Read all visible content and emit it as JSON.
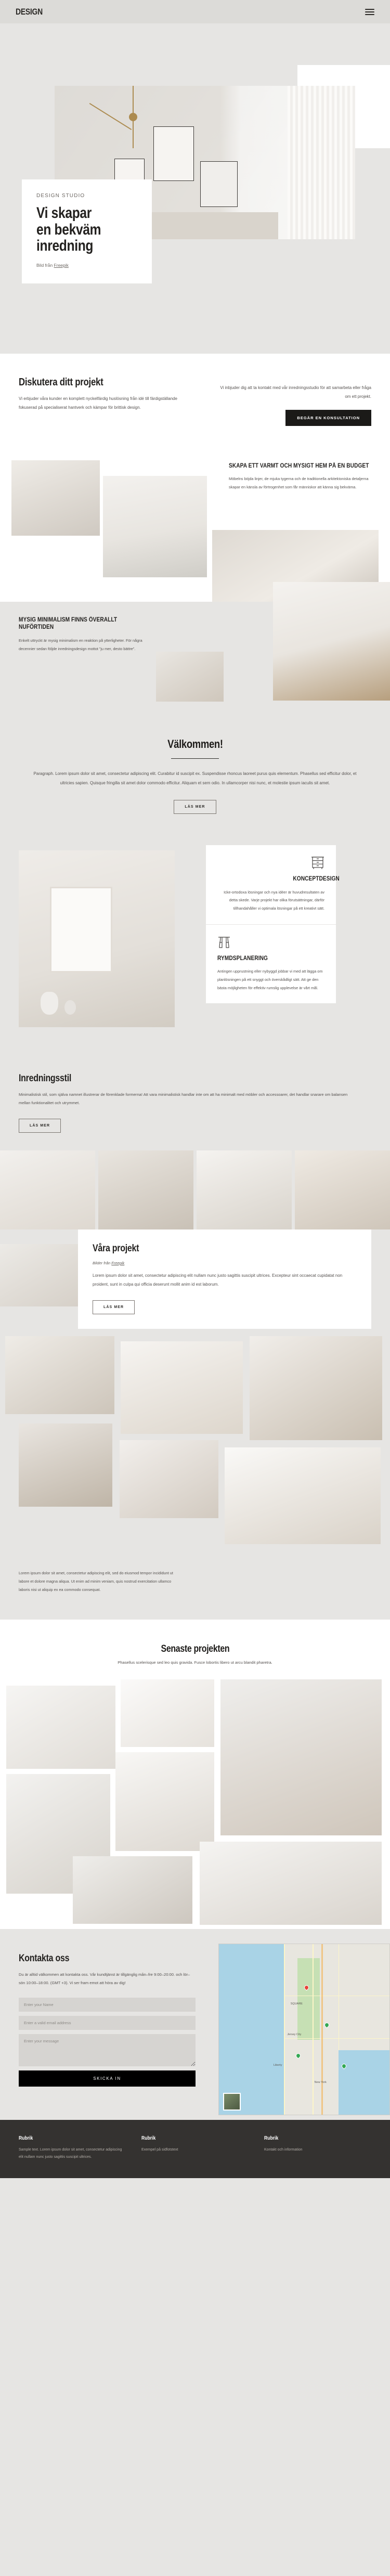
{
  "header": {
    "logo": "DESIGN",
    "menu_icon": "hamburger-icon"
  },
  "hero": {
    "eyebrow": "DESIGN STUDIO",
    "title_line1": "Vi skapar",
    "title_line2": "en bekväm",
    "title_line3": "inredning",
    "credit_prefix": "Bild från ",
    "credit_link": "Freepik"
  },
  "discuss": {
    "heading": "Diskutera ditt projekt",
    "paragraph": "Vi erbjuder våra kunder en komplett nyckelfärdig huslösning från idé till färdigställande fokuserad på specialiserat hantverk och kämpar för brittisk design.",
    "right_text": "Vi inbjuder dig att ta kontakt med vår inredningsstudio för att samarbeta eller fråga om ett projekt.",
    "button": "BEGÄR EN KONSULTATION"
  },
  "feature_warm": {
    "heading": "SKAPA ETT VARMT OCH MYSIGT HEM PÅ EN BUDGET",
    "paragraph": "Möbelns böjda linjer, de mjuka tygerna och de traditionella arkitektoniska detaljerna skapar en känsla av förtrogenhet som får människor att känna sig bekväma."
  },
  "feature_minimal": {
    "heading": "MYSIG MINIMALISM FINNS ÖVERALLT NUFÖRTIDEN",
    "paragraph": "Enkelt uttryckt är mysig minimalism en reaktion på ytterligheter. För några decennier sedan följde inredningsdesign mottot ”ju mer, desto bättre”."
  },
  "welcome": {
    "heading": "Välkommen!",
    "paragraph": "Paragraph. Lorem ipsum dolor sit amet, consectetur adipiscing elit. Curabitur id suscipit ex. Suspendisse rhoncus laoreet purus quis elementum. Phasellus sed efficitur dolor, et ultricies sapien. Quisque fringilla sit amet dolor commodo efficitur. Aliquam et sem odio. In ullamcorper nisi nunc, et molestie ipsum iaculis sit amet.",
    "button": "LÄS MER"
  },
  "services": [
    {
      "icon": "dresser-icon",
      "title": "KONCEPTDESIGN",
      "text": "Icke-ortodoxa lösningar och nya idéer är huvudresultaten av detta skede. Varje projekt har olika förutsättningar, därför tillhandahåller vi optimala lösningar på ett kreativt sätt."
    },
    {
      "icon": "curtains-icon",
      "title": "RYMDSPLANERING",
      "text": "Antingen upprustning eller nybyggd jobbar vi med att lägga om planlösningen på ett snyggt och överskådligt sätt. Att ge den bästa möjligheten för effektiv rumslig upplevelse är vårt mål."
    }
  ],
  "style_section": {
    "heading": "Inredningsstil",
    "paragraph": "Minimalistisk stil, som själva namnet illustrerar de förenklade formerna! Att vara minimalistisk handlar inte om att ha minimalt med möbler och accessoarer, det handlar snarare om balansen mellan funktionalitet och utrymmet.",
    "button": "LÄS MER"
  },
  "projects": {
    "heading": "Våra projekt",
    "credit_prefix": "Bilder från ",
    "credit_link": "Freepik",
    "paragraph": "Lorem ipsum dolor sit amet, consectetur adipiscing elit nullam nunc justo sagittis suscipit ultrices. Excepteur sint occaecat cupidatat non proident, sunt in culpa qui officia deserunt mollit anim id est laborum.",
    "button": "LÄS MER",
    "footer_text": "Lorem ipsum dolor sit amet, consectetur adipiscing elit, sed do eiusmod tempor incididunt ut labore et dolore magna aliqua. Ut enim ad minim veniam, quis nostrud exercitation ullamco laboris nisi ut aliquip ex ea commodo consequat."
  },
  "latest": {
    "heading": "Senaste projekten",
    "subtitle": "Phasellus scelerisque sed leo quis gravida. Fusce lobortis libero ut arcu blandit pharetra."
  },
  "contact": {
    "heading": "Kontakta oss",
    "paragraph": "Du är alltid välkommen att kontakta oss. Vår kundtjänst är tillgänglig mån–fre 9:00–20:00. och lör–sön 10:00–18:00. (GMT +3). Vi ser fram emot att höra av dig!",
    "name_placeholder": "Enter your Name",
    "email_placeholder": "Enter a valid email address",
    "message_placeholder": "Enter your message",
    "submit": "SKICKA IN",
    "map_labels": [
      "New York",
      "Jersey City",
      "SQUARE",
      "Liberty"
    ]
  },
  "footer": [
    {
      "title": "Rubrik",
      "text": "Sample text. Lorem ipsum dolor sit amet, consectetur adipiscing elit nullam nunc justo sagittis suscipit ultrices."
    },
    {
      "title": "Rubrik",
      "text": "Exempel på sidfotstext"
    },
    {
      "title": "Rubrik",
      "text": "Kontakt och information"
    }
  ],
  "colors": {
    "accent": "#1b1a18",
    "bg": "#e6e5e3",
    "panel": "#ffffff",
    "footer": "#343230"
  }
}
